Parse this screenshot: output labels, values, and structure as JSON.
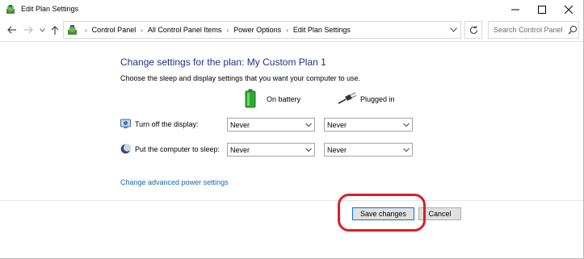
{
  "window": {
    "title": "Edit Plan Settings",
    "icons": {
      "app": "power-options-icon",
      "minimize": "minimize-icon",
      "maximize": "maximize-icon",
      "close": "close-icon"
    }
  },
  "nav": {
    "breadcrumbs": [
      "Control Panel",
      "All Control Panel Items",
      "Power Options",
      "Edit Plan Settings"
    ],
    "search_placeholder": "Search Control Panel",
    "icons": {
      "back": "arrow-left-icon",
      "forward": "arrow-right-icon",
      "recent": "chevron-down-icon",
      "up": "arrow-up-icon",
      "location": "control-panel-icon",
      "refresh": "refresh-icon",
      "search": "search-icon"
    }
  },
  "main": {
    "heading": "Change settings for the plan: My Custom Plan 1",
    "subtext": "Choose the sleep and display settings that you want your computer to use.",
    "columns": {
      "on_battery": {
        "label": "On battery",
        "icon": "battery-icon"
      },
      "plugged_in": {
        "label": "Plugged in",
        "icon": "power-plug-icon"
      }
    },
    "rows": [
      {
        "label": "Turn off the display:",
        "icon": "display-icon",
        "on_battery": "Never",
        "plugged_in": "Never"
      },
      {
        "label": "Put the computer to sleep:",
        "icon": "sleep-moon-icon",
        "on_battery": "Never",
        "plugged_in": "Never"
      }
    ],
    "advanced_link": "Change advanced power settings"
  },
  "actions": {
    "save_label": "Save changes",
    "cancel_label": "Cancel"
  },
  "colors": {
    "heading": "#1e3287",
    "link": "#1a66b3",
    "highlight": "#d6202a"
  }
}
